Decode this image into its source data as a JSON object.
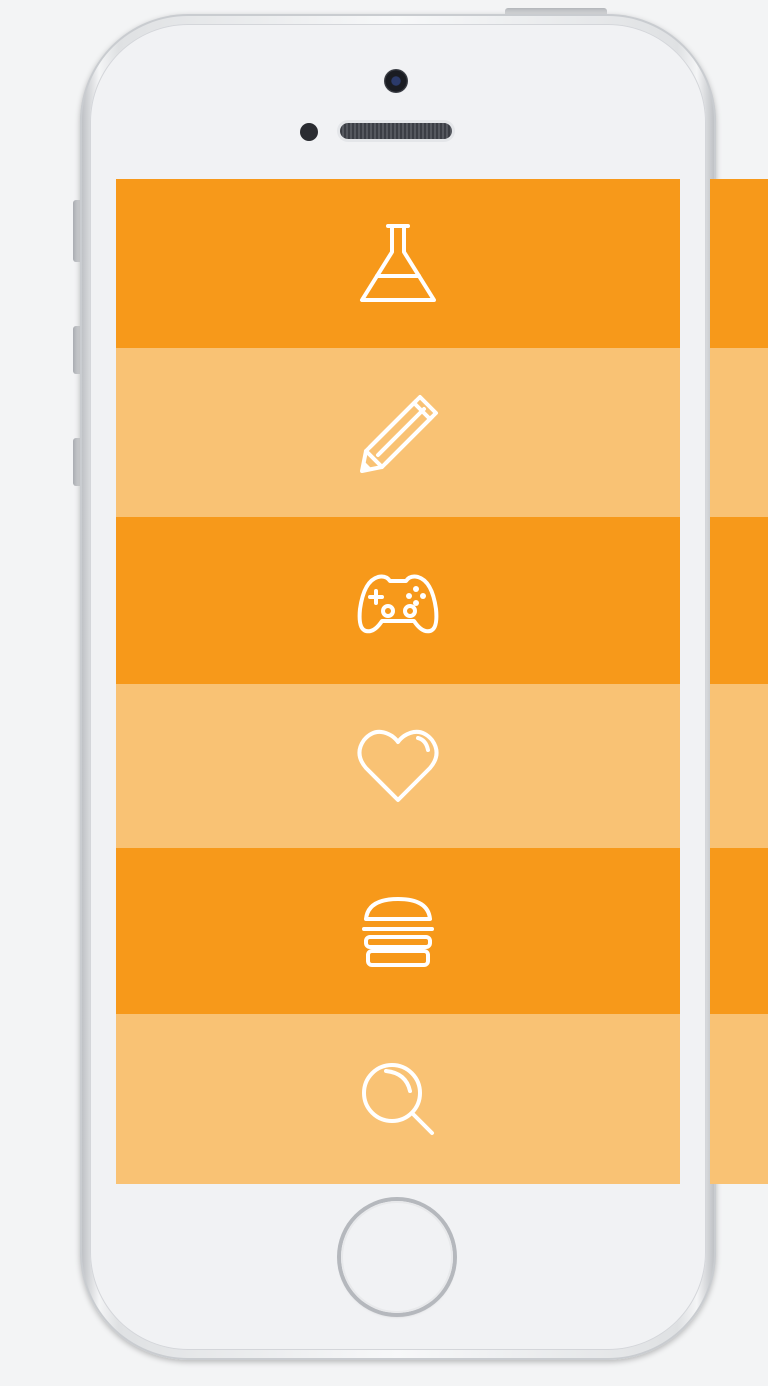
{
  "theme": {
    "dark": "#f7991a",
    "light": "#f9c274",
    "icon": "#ffffff"
  },
  "menu": {
    "items": [
      {
        "icon": "flask-icon",
        "shade": "dark"
      },
      {
        "icon": "pencil-icon",
        "shade": "light"
      },
      {
        "icon": "gamepad-icon",
        "shade": "dark"
      },
      {
        "icon": "heart-icon",
        "shade": "light"
      },
      {
        "icon": "burger-icon",
        "shade": "dark"
      },
      {
        "icon": "magnifier-icon",
        "shade": "light"
      }
    ]
  },
  "next_screen": {
    "stripes": [
      "dark",
      "light",
      "dark",
      "light",
      "dark",
      "light"
    ]
  }
}
